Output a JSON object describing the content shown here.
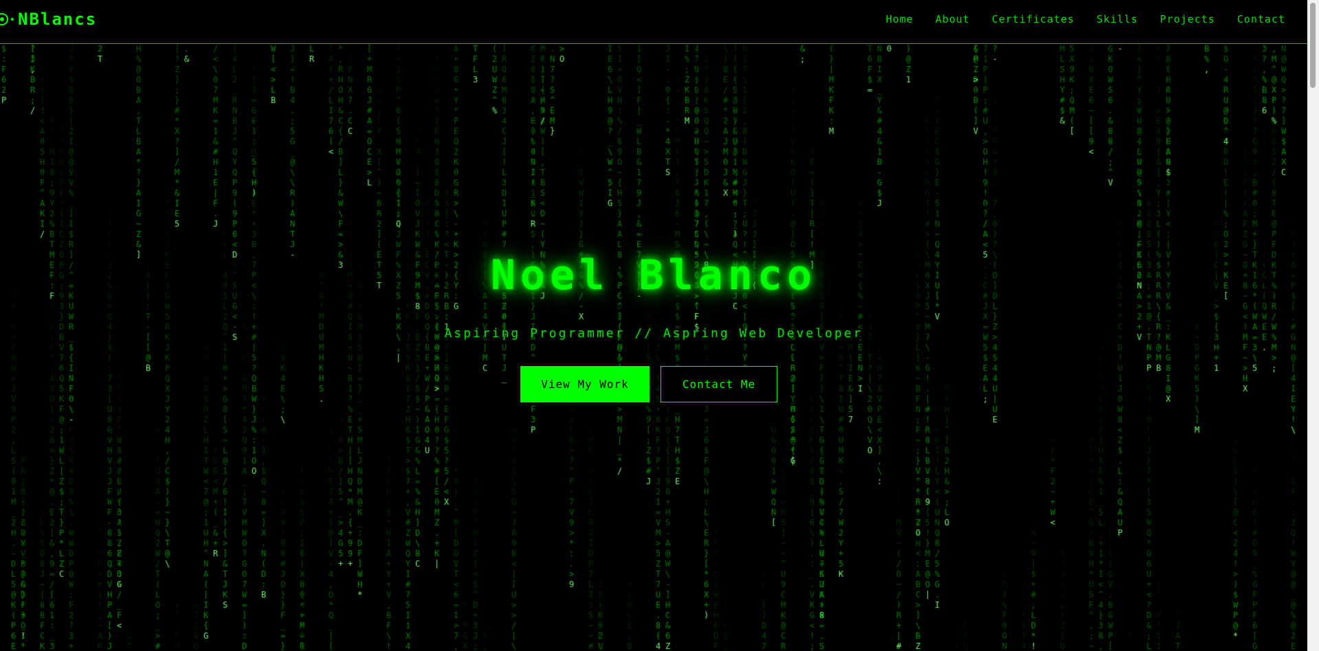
{
  "brand": {
    "name": "NBlancs",
    "accent_color": "#00ff00",
    "background_color": "#000000"
  },
  "nav": {
    "links": [
      "Home",
      "About",
      "Certificates",
      "Skills",
      "Projects",
      "Contact"
    ]
  },
  "hero": {
    "name": "Noel Blanco",
    "subtitle": "Aspiring Programmer // Aspring Web Developer",
    "primary_button": "View My Work",
    "secondary_button": "Contact Me"
  },
  "background_effect": {
    "type": "matrix-digital-rain",
    "charset": "ABCDEFGHIJKLMNOPQRSTUVWXYZ0123456789@#$%^&*()[]{}<>/\\|~!?:;=+-_.,"
  }
}
